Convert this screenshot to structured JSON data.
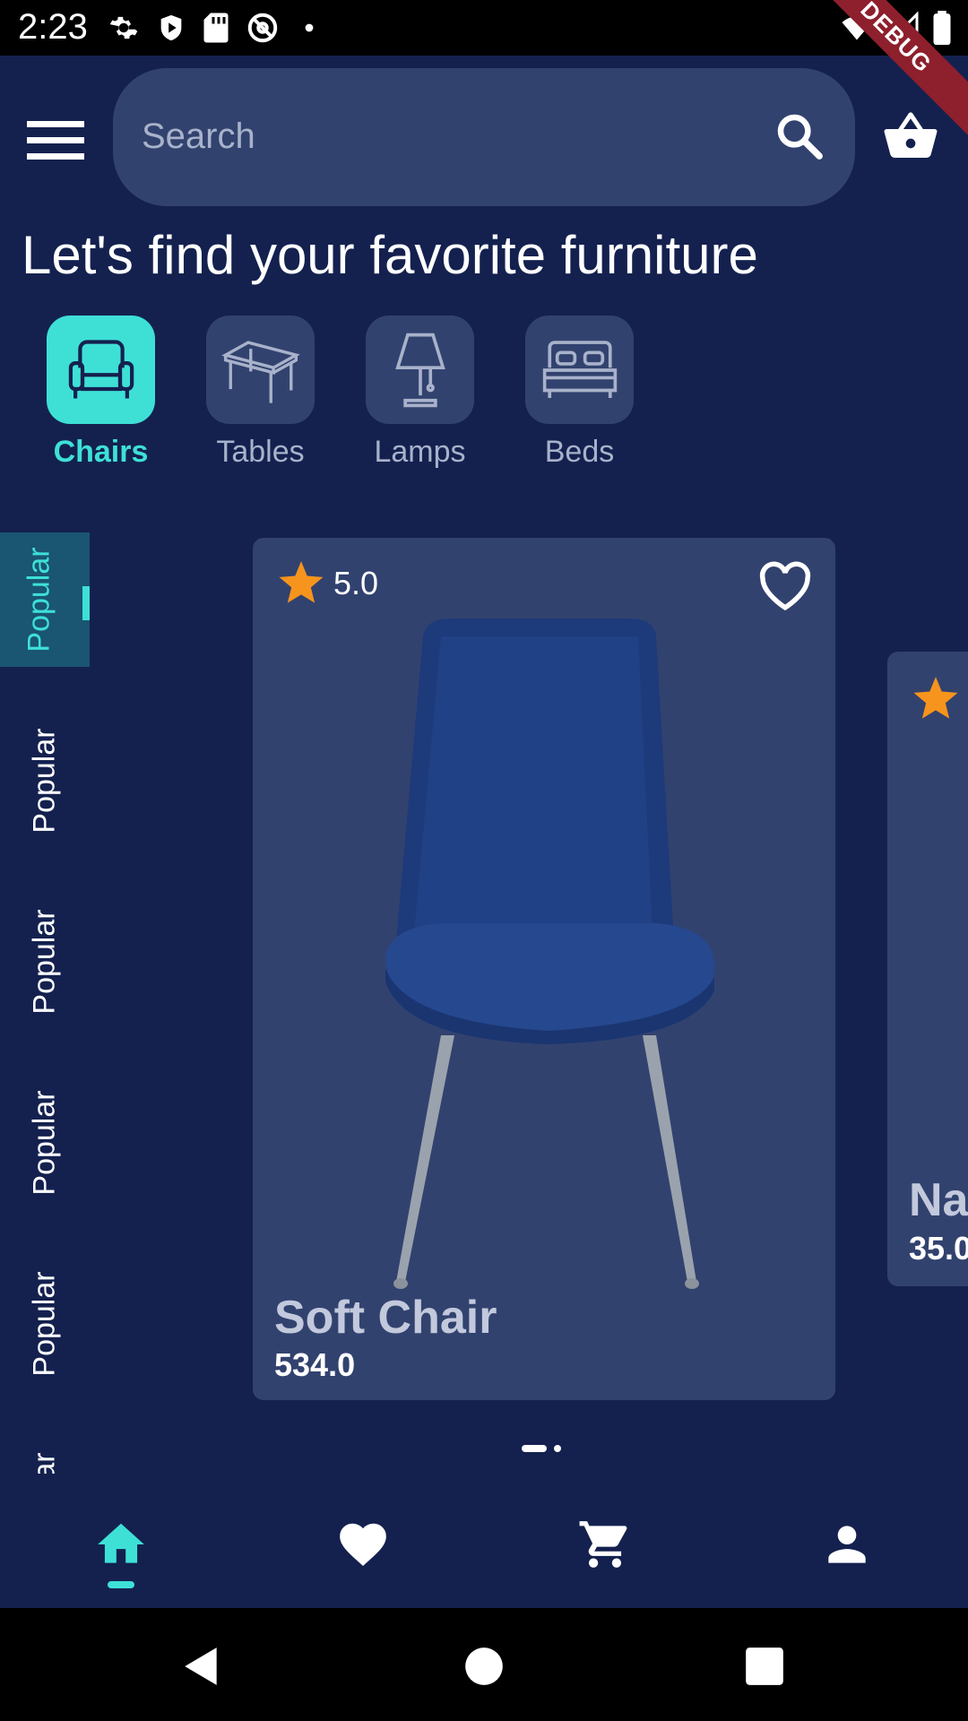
{
  "status_bar": {
    "time": "2:23",
    "left_icons": [
      "settings-icon",
      "shield-play-icon",
      "sd-card-icon",
      "at-sign-icon",
      "dot-icon"
    ],
    "right_icons": [
      "wifi-icon",
      "signal-icon",
      "battery-icon"
    ],
    "debug_banner": "DEBUG"
  },
  "header": {
    "menu_icon": "hamburger-menu-icon",
    "search": {
      "placeholder": "Search",
      "value": ""
    },
    "basket_icon": "basket-icon"
  },
  "headline": "Let's find your favorite furniture",
  "categories": [
    {
      "label": "Chairs",
      "icon": "armchair-icon",
      "active": true
    },
    {
      "label": "Tables",
      "icon": "table-icon",
      "active": false
    },
    {
      "label": "Lamps",
      "icon": "lamp-icon",
      "active": false
    },
    {
      "label": "Beds",
      "icon": "bed-icon",
      "active": false
    }
  ],
  "side_rail": {
    "items": [
      "Popular",
      "Popular",
      "Popular",
      "Popular",
      "Popular",
      "Popular"
    ],
    "active_index": 0
  },
  "products": [
    {
      "name": "Soft Chair",
      "price": "534.0",
      "rating": "5.0",
      "favorite": false
    },
    {
      "name": "Na",
      "price": "35.0"
    }
  ],
  "pager": {
    "count": 2,
    "active": 0
  },
  "bottom_nav": {
    "items": [
      "home-icon",
      "heart-icon",
      "cart-icon",
      "person-icon"
    ],
    "active": 0
  },
  "system_nav": [
    "back-icon",
    "home-circle-icon",
    "recents-icon"
  ],
  "colors": {
    "background": "#14214f",
    "card": "#32426f",
    "accent": "#3ee0d6",
    "muted_text": "#a8b2ca",
    "star": "#f7941d"
  }
}
